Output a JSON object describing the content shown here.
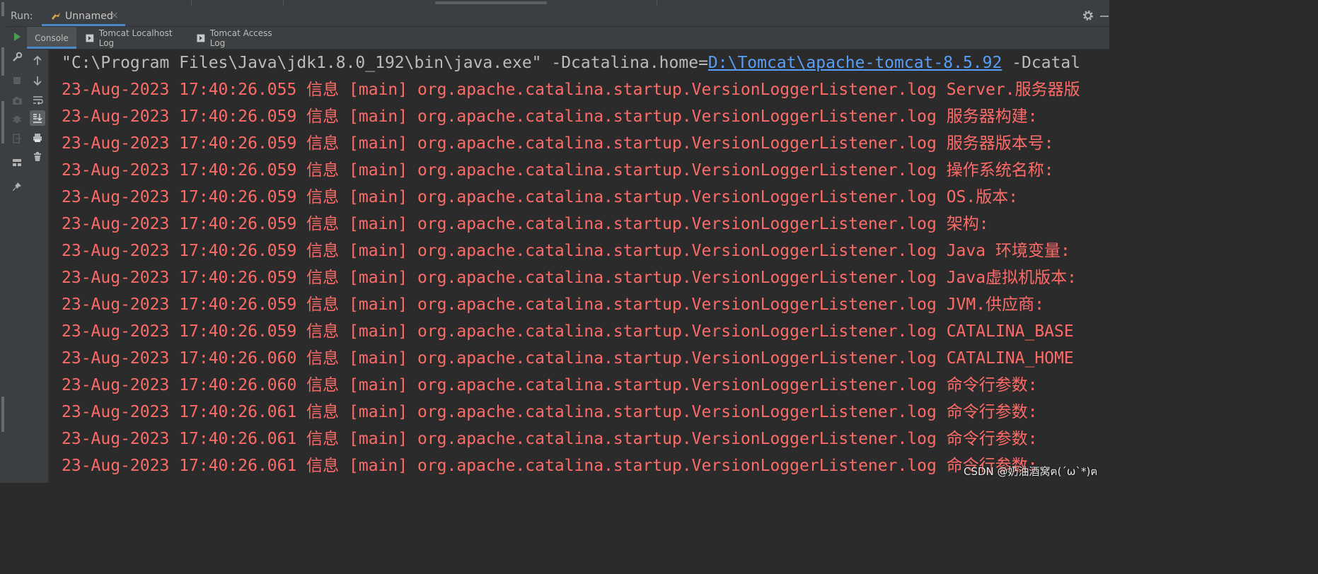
{
  "run_bar": {
    "label": "Run:",
    "tab_label": "Unnamed",
    "tab_close": "×",
    "tab_icon": "tomcat-icon",
    "settings_icon": "gear-icon",
    "minimize_icon": "minimize-icon"
  },
  "subtabs": [
    {
      "label": "Console",
      "icon": null,
      "active": true
    },
    {
      "label": "Tomcat Localhost Log",
      "icon": "log-tab-icon",
      "active": false
    },
    {
      "label": "Tomcat Access Log",
      "icon": "log-tab-icon",
      "active": false
    }
  ],
  "outer_toolbar": [
    "rerun-icon",
    "wrench-icon",
    "stop-icon",
    "camera-icon",
    "debug-icon",
    "exit-icon",
    "layout-icon",
    "pin-icon"
  ],
  "inner_toolbar": [
    "up-arrow-icon",
    "down-arrow-icon",
    "soft-wrap-icon",
    "scroll-to-end-icon",
    "print-icon",
    "trash-icon"
  ],
  "console": {
    "command": {
      "prefix": "\"C:\\Program Files\\Java\\jdk1.8.0_192\\bin\\java.exe\" -Dcatalina.home=",
      "link": "D:\\Tomcat\\apache-tomcat-8.5.92",
      "suffix": " -Dcatal"
    },
    "log_lines": [
      "23-Aug-2023 17:40:26.055 信息 [main] org.apache.catalina.startup.VersionLoggerListener.log Server.服务器版",
      "23-Aug-2023 17:40:26.059 信息 [main] org.apache.catalina.startup.VersionLoggerListener.log 服务器构建:",
      "23-Aug-2023 17:40:26.059 信息 [main] org.apache.catalina.startup.VersionLoggerListener.log 服务器版本号:",
      "23-Aug-2023 17:40:26.059 信息 [main] org.apache.catalina.startup.VersionLoggerListener.log 操作系统名称:",
      "23-Aug-2023 17:40:26.059 信息 [main] org.apache.catalina.startup.VersionLoggerListener.log OS.版本:",
      "23-Aug-2023 17:40:26.059 信息 [main] org.apache.catalina.startup.VersionLoggerListener.log 架构:",
      "23-Aug-2023 17:40:26.059 信息 [main] org.apache.catalina.startup.VersionLoggerListener.log Java 环境变量:",
      "23-Aug-2023 17:40:26.059 信息 [main] org.apache.catalina.startup.VersionLoggerListener.log Java虚拟机版本:",
      "23-Aug-2023 17:40:26.059 信息 [main] org.apache.catalina.startup.VersionLoggerListener.log JVM.供应商:",
      "23-Aug-2023 17:40:26.059 信息 [main] org.apache.catalina.startup.VersionLoggerListener.log CATALINA_BASE",
      "23-Aug-2023 17:40:26.060 信息 [main] org.apache.catalina.startup.VersionLoggerListener.log CATALINA_HOME",
      "23-Aug-2023 17:40:26.060 信息 [main] org.apache.catalina.startup.VersionLoggerListener.log 命令行参数:",
      "23-Aug-2023 17:40:26.061 信息 [main] org.apache.catalina.startup.VersionLoggerListener.log 命令行参数:",
      "23-Aug-2023 17:40:26.061 信息 [main] org.apache.catalina.startup.VersionLoggerListener.log 命令行参数:",
      "23-Aug-2023 17:40:26.061 信息 [main] org.apache.catalina.startup.VersionLoggerListener.log 命令行参数:"
    ]
  },
  "watermark": "CSDN @奶油酒窝ฅ(´ω`*)ฅ",
  "colors": {
    "background": "#2b2b2b",
    "panel": "#3c3f41",
    "accent": "#4a88c7",
    "log_text": "#ff6b68",
    "link": "#589df6",
    "run_icon": "#499c54"
  }
}
